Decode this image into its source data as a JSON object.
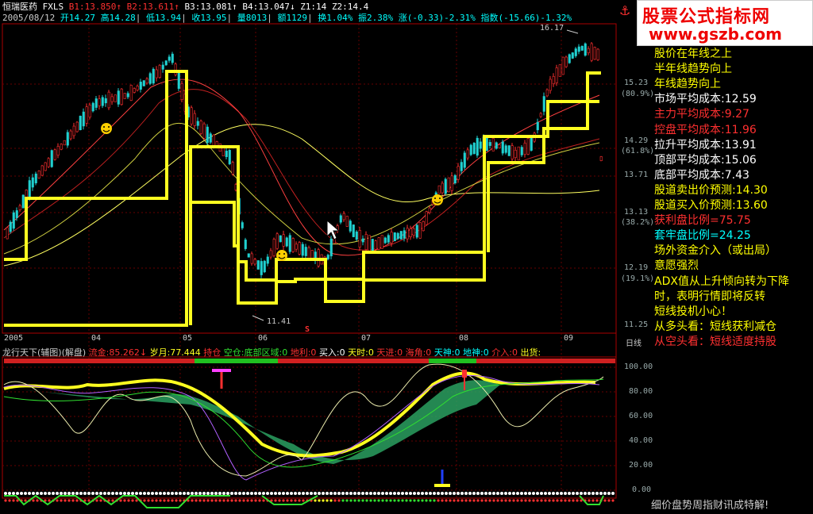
{
  "header": {
    "stock_name": "恒瑞医药",
    "indicator": "FXLS",
    "b1": "B1:13.850",
    "b2": "B2:13.611",
    "b3": "B3:13.081",
    "b4": "B4:13.047",
    "z1": "Z1:14",
    "z2": "Z2:14.4",
    "date": "2005/08/12",
    "open": "开14.27",
    "high": "高14.28",
    "low": "低13.94",
    "close": "收13.95",
    "volume": "量8013",
    "amount": "额1129",
    "turnover": "换1.04%",
    "amplitude": "振2.38%",
    "change": "涨(-0.33)-2.31%",
    "index": "指数(-15.66)-1.32%"
  },
  "price_axis": {
    "labels": [
      "15.23",
      "14.29",
      "13.71",
      "13.13",
      "12.19",
      "11.25"
    ],
    "pct_labels": [
      "(80.9%)",
      "(61.8%)",
      "(38.2%)",
      "(19.1%)"
    ],
    "high_mark": "16.17",
    "low_mark": "11.41",
    "s_mark": "S"
  },
  "time_axis": {
    "labels": [
      "2005",
      "04",
      "05",
      "06",
      "07",
      "08",
      "09"
    ],
    "period": "日线"
  },
  "brand": {
    "title": "股票公式指标网",
    "url": "www.gszb.com"
  },
  "side_info": [
    {
      "text": "股价在年线之上",
      "color": "#ffff00"
    },
    {
      "text": "半年线趋势向上",
      "color": "#ffff00"
    },
    {
      "text": "年线趋势向上",
      "color": "#ffff00"
    },
    {
      "text": "市场平均成本:12.59",
      "color": "#ffffff"
    },
    {
      "text": "主力平均成本:9.27",
      "color": "#ff3030"
    },
    {
      "text": "控盘平均成本:11.96",
      "color": "#ff3030"
    },
    {
      "text": "拉升平均成本:13.91",
      "color": "#ffffff"
    },
    {
      "text": "顶部平均成本:15.06",
      "color": "#ffffff"
    },
    {
      "text": "底部平均成本:7.43",
      "color": "#ffffff"
    },
    {
      "text": "股道卖出价预测:14.30",
      "color": "#ffff00"
    },
    {
      "text": "股道买入价预测:13.60",
      "color": "#ffff00"
    },
    {
      "text": "获利盘比例=75.75",
      "color": "#ff3030"
    },
    {
      "text": "套牢盘比例=24.25",
      "color": "#00ffff"
    },
    {
      "text": "场外资金介入（或出局）",
      "color": "#ffff00"
    },
    {
      "text": "意愿强烈",
      "color": "#ffff00"
    },
    {
      "text": "ADX值从上升倾向转为下降",
      "color": "#ffff00"
    },
    {
      "text": "时，表明行情即将反转",
      "color": "#ffff00"
    },
    {
      "text": "短线投机小心！",
      "color": "#ffff00"
    },
    {
      "text": "从多头看：短线获利减仓",
      "color": "#ffff00"
    },
    {
      "text": "从空头看：短线适度持股",
      "color": "#ff3030"
    }
  ],
  "sub_chart": {
    "title": "龙行天下(辅图)(解盘)",
    "liujin": "流金:85.262",
    "suiyue": "岁月:77.444",
    "chicang": "持仓",
    "kongcang": "空仓:底部区域:0",
    "dili": "地利:0",
    "mairu": "买入:0",
    "tianshi": "天时:0",
    "tianjin": "天进:0",
    "haijiao": "海角:0",
    "tianshen": "天神:0",
    "dishen": "地神:0",
    "jieru": "介入:0",
    "chuhuo": "出货:",
    "axis": [
      "100.00",
      "80.00",
      "60.00",
      "40.00",
      "20.00",
      "0.00"
    ]
  },
  "footer_scroll": "细价盘势周指财讯成特解!",
  "corner_icon": "anchor-icon"
}
